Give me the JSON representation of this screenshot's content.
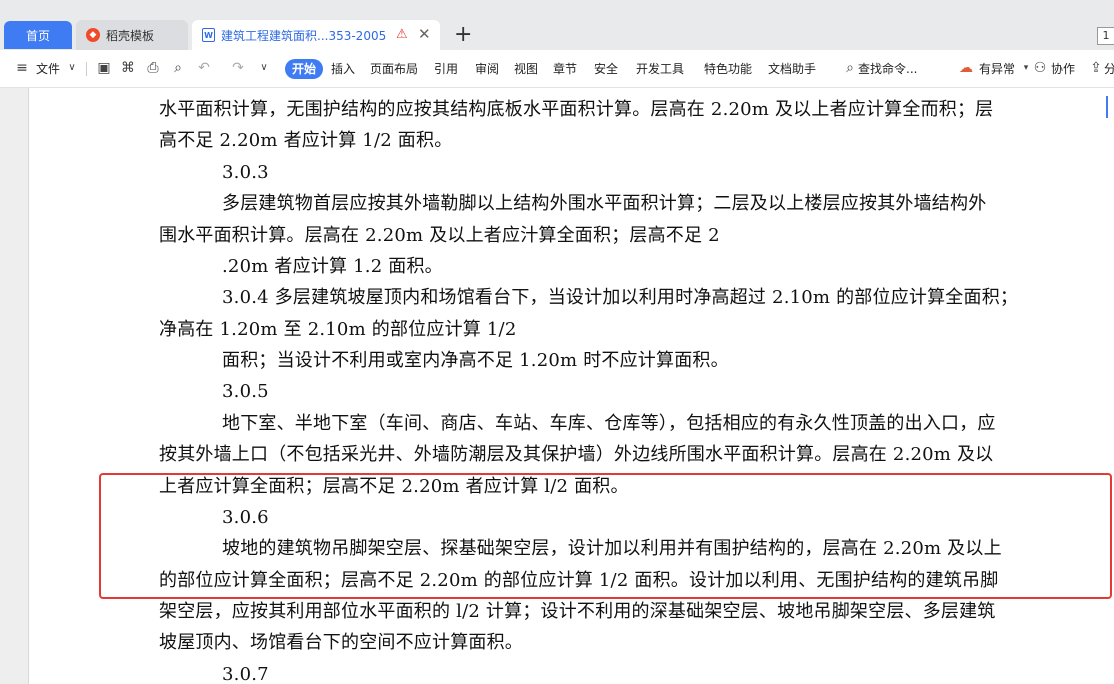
{
  "tabs": {
    "home": "首页",
    "daoke": "稻壳模板",
    "doc": "建筑工程建筑面积...353-2005",
    "count": "1"
  },
  "ribbon": {
    "file": "文件",
    "start": "开始",
    "insert": "插入",
    "layout": "页面布局",
    "reference": "引用",
    "review": "审阅",
    "view": "视图",
    "chapter": "章节",
    "security": "安全",
    "devtools": "开发工具",
    "features": "特色功能",
    "assistant": "文档助手",
    "search": "查找命令...",
    "status": "有异常",
    "collab": "协作",
    "share": "分"
  },
  "document": {
    "lines": [
      "水平面积计算，无围护结构的应按其结构底板水平面积计算。层高在 2.20m 及以上者应计算全而积；层",
      "高不足 2.20m 者应计算 1/2 面积。",
      "3.0.3",
      "多层建筑物首层应按其外墙勒脚以上结构外围水平面积计算；二层及以上楼层应按其外墙结构外",
      "围水平面积计算。层高在 2.20m 及以上者应汁算全面积；层高不足 2",
      ".20m 者应计算 1.2 面积。",
      "3.0.4  多层建筑坡屋顶内和场馆看台下，当设计加以利用时净高超过 2.10m 的部位应计算全面积；",
      "净高在 1.20m 至 2.10m 的部位应计算 1/2",
      "面积；当设计不利用或室内净高不足 1.20m 时不应计算面积。",
      "3.0.5",
      "地下室、半地下室（车间、商店、车站、车库、仓库等），包括相应的有永久性顶盖的出入口，应",
      "按其外墙上口（不包括采光井、外墙防潮层及其保护墙）外边线所围水平面积计算。层高在 2.20m 及以",
      "上者应计算全面积；层高不足 2.20m 者应计算 l/2 面积。",
      "3.0.6",
      "坡地的建筑物吊脚架空层、探基础架空层，设计加以利用并有围护结构的，层高在 2.20m 及以上",
      "的部位应计算全面积；层高不足 2.20m 的部位应计算 1/2 面积。设计加以利用、无围护结构的建筑吊脚",
      "架空层，应按其利用部位水平面积的 l/2 计算；设计不利用的深基础架空层、坡地吊脚架空层、多层建筑",
      "坡屋顶内、场馆看台下的空间不应计算面积。",
      "3.0.7"
    ]
  }
}
